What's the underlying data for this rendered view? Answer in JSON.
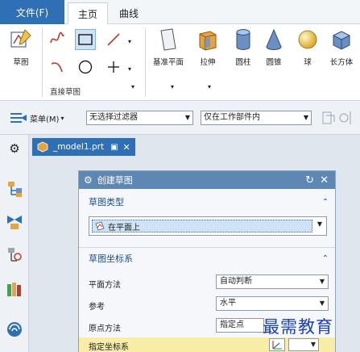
{
  "menu": {
    "file": "文件(F)",
    "tabs": [
      "主页",
      "曲线"
    ]
  },
  "ribbon": {
    "sketch": "草图",
    "direct_sketch_group": "直接草图",
    "feature_buttons": [
      "基准平面",
      "拉伸",
      "圆柱",
      "圆锥",
      "球",
      "长方体"
    ]
  },
  "selection_bar": {
    "menu_label": "菜单(M)",
    "filter": "无选择过滤器",
    "scope": "仅在工作部件内"
  },
  "document": {
    "tab_label": "_model1.prt"
  },
  "dialog": {
    "title": "创建草图",
    "sketch_type_header": "草图类型",
    "sketch_type_value": "在平面上",
    "csys_header": "草图坐标系",
    "rows": [
      {
        "label": "平面方法",
        "value": "自动判断"
      },
      {
        "label": "参考",
        "value": "水平"
      },
      {
        "label": "原点方法",
        "value": "指定点"
      }
    ],
    "specify_csys": "指定坐标系"
  },
  "watermark": "最需教育",
  "colors": {
    "accent": "#2e6fb6",
    "dialog_title": "#5f87b3",
    "header_text": "#1e4f8a",
    "watermark": "#1a3fbf"
  }
}
